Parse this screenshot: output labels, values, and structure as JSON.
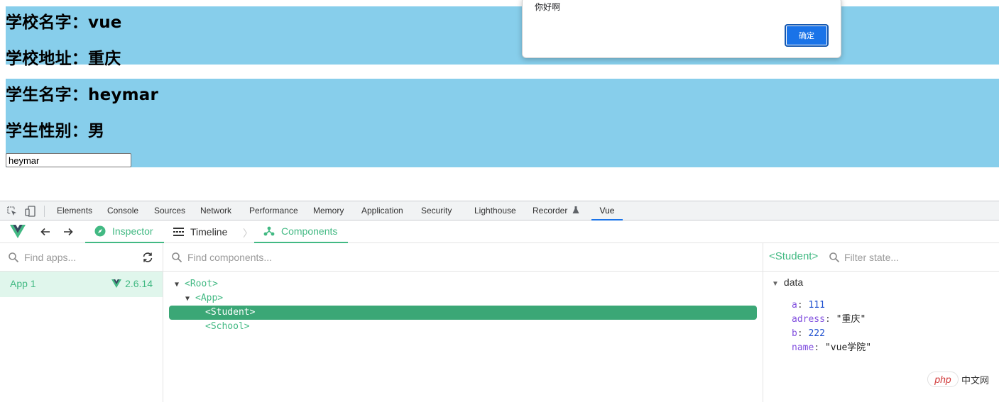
{
  "page": {
    "school": {
      "name_line": "学校名字：vue",
      "address_line": "学校地址：重庆"
    },
    "student": {
      "name_line": "学生名字：heymar",
      "gender_line": "学生性别：男",
      "input_value": "heymar"
    }
  },
  "alert": {
    "message": "你好啊",
    "ok_label": "确定"
  },
  "devtools": {
    "tabs": [
      "Elements",
      "Console",
      "Sources",
      "Network",
      "Performance",
      "Memory",
      "Application",
      "Security",
      "Lighthouse",
      "Recorder",
      "Vue"
    ],
    "active_tab": "Vue"
  },
  "vue": {
    "tabs": {
      "inspector": "Inspector",
      "timeline": "Timeline",
      "components": "Components"
    },
    "apps": {
      "search_placeholder": "Find apps...",
      "app_name": "App 1",
      "version": "2.6.14"
    },
    "components": {
      "search_placeholder": "Find components...",
      "tree": [
        "<Root>",
        "<App>",
        "<Student>",
        "<School>"
      ]
    },
    "state": {
      "component": "<Student>",
      "filter_placeholder": "Filter state...",
      "section": "data",
      "props": [
        {
          "key": "a",
          "value": "111"
        },
        {
          "key": "adress",
          "value": "\"重庆\""
        },
        {
          "key": "b",
          "value": "222"
        },
        {
          "key": "name",
          "value": "\"vue学院\""
        }
      ]
    }
  },
  "watermark": {
    "badge": "php",
    "text": "中文网"
  },
  "colors": {
    "box_bg": "#87ceeb",
    "vue_green": "#42b983",
    "selected_row": "#3ba776",
    "alert_button": "#1a73e8"
  },
  "icons": [
    "inspect-element-icon",
    "device-toggle-icon",
    "flask-icon",
    "vue-logo-icon",
    "back-arrow-icon",
    "forward-arrow-icon",
    "compass-icon",
    "timeline-icon",
    "components-icon",
    "search-icon",
    "refresh-icon",
    "vue-version-icon",
    "triangle-down-icon"
  ]
}
